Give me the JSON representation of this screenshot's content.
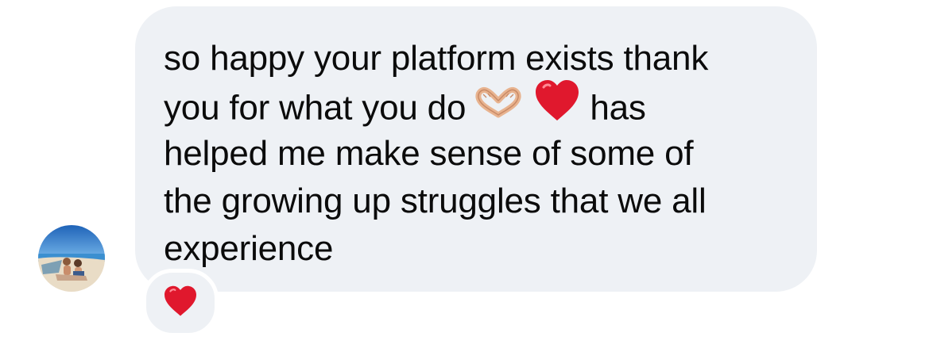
{
  "message": {
    "lines": [
      "so happy your platform exists thank",
      "you for what you do",
      "has",
      "helped me make sense  of some of",
      "the growing up struggles that we all",
      "experience"
    ],
    "inline_emojis": [
      "heart-hands-icon",
      "red-heart-icon"
    ]
  },
  "reaction": {
    "emoji": "red-heart-icon"
  },
  "colors": {
    "bubble": "#eef1f5",
    "text": "#0b0b0b",
    "heart": "#e0182d"
  }
}
